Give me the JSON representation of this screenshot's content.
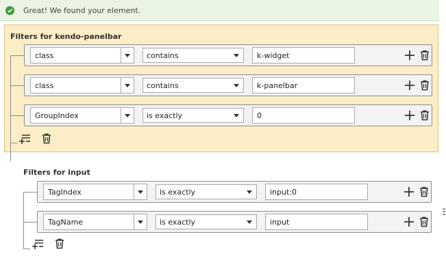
{
  "banner": {
    "message": "Great! We found your element."
  },
  "groups": [
    {
      "title": "Filters for kendo-panelbar",
      "rows": [
        {
          "attribute": "class",
          "operator": "contains",
          "value": "k-widget"
        },
        {
          "attribute": "class",
          "operator": "contains",
          "value": "k-panelbar"
        },
        {
          "attribute": "GroupIndex",
          "operator": "is exactly",
          "value": "0"
        }
      ]
    },
    {
      "title": "Filters for input",
      "rows": [
        {
          "attribute": "TagIndex",
          "operator": "is exactly",
          "value": "input:0"
        },
        {
          "attribute": "TagName",
          "operator": "is exactly",
          "value": "input"
        }
      ]
    }
  ],
  "colors": {
    "success": "#3d9a3d",
    "banner_bg": "#e9f4e4",
    "group_highlight": "#fbeec7",
    "group_border": "#dfc27b"
  },
  "icons": [
    "check-circle-icon",
    "chevron-down-icon",
    "plus-icon",
    "trash-icon",
    "add-filter-icon"
  ]
}
